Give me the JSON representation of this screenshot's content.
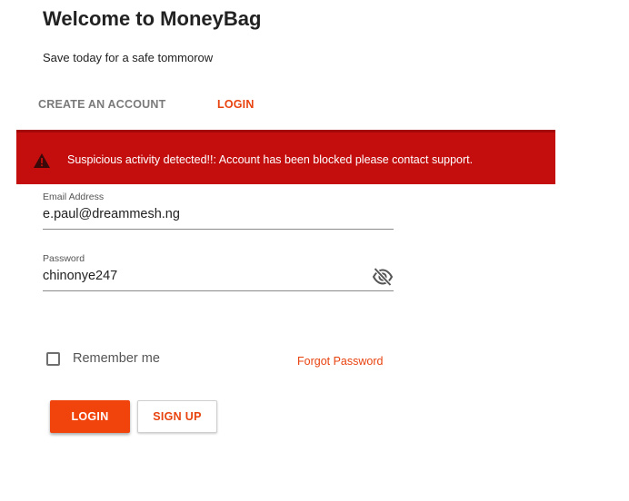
{
  "header": {
    "title": "Welcome to MoneyBag",
    "subtitle": "Save today for a safe tommorow"
  },
  "tabs": [
    {
      "label": "CREATE AN ACCOUNT",
      "active": false
    },
    {
      "label": "LOGIN",
      "active": true
    }
  ],
  "alert": {
    "icon": "warning-icon",
    "message": "Suspicious activity detected!!: Account has been blocked please contact support.",
    "background_color": "#c40e0e"
  },
  "form": {
    "email": {
      "label": "Email Address",
      "value": "e.paul@dreammesh.ng"
    },
    "password": {
      "label": "Password",
      "value": "chinonye247",
      "visibility_icon": "eye-off-icon"
    },
    "remember_me": {
      "label": "Remember me",
      "checked": false
    },
    "forgot_password": "Forgot Password",
    "login_button": "LOGIN",
    "signup_button": "SIGN UP"
  },
  "colors": {
    "accent": "#e8430f",
    "alert": "#c40e0e"
  }
}
